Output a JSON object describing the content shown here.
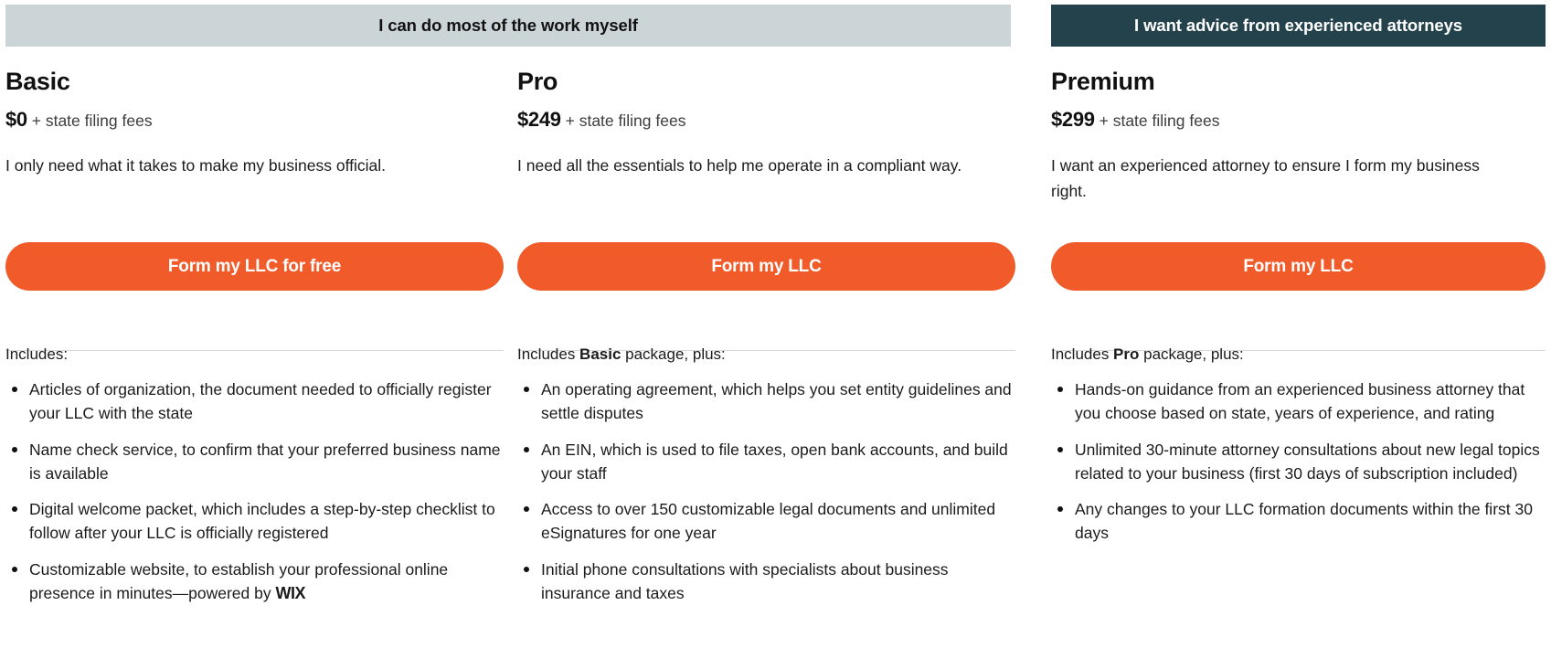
{
  "theme": {
    "accent_orange": "#f15a29",
    "banner_gray": "#cbd4d7",
    "banner_dark": "#24424c",
    "text_dark": "#111111",
    "divider": "#d6d9dc"
  },
  "banners": {
    "left": "I can do most of the work myself",
    "right": "I want advice from experienced attorneys"
  },
  "plans": [
    {
      "name": "Basic",
      "price": "$0",
      "price_suffix": "+ state filing fees",
      "description": "I only need what it takes to make my business official.",
      "cta": "Form my LLC for free",
      "includes_prefix": "Includes:",
      "includes_bold": "",
      "includes_suffix": "",
      "features": [
        "Articles of organization, the document needed to officially register your LLC with the state",
        "Name check service, to confirm that your preferred business name is available",
        "Digital welcome packet, which includes a step-by-step checklist to follow after your LLC is officially registered",
        "Customizable website, to establish your professional online presence in minutes—powered by "
      ],
      "last_feature_brand": "WIX"
    },
    {
      "name": "Pro",
      "price": "$249",
      "price_suffix": "+ state filing fees",
      "description": "I need all the essentials to help me operate in a compliant way.",
      "cta": "Form my LLC",
      "includes_prefix": "Includes ",
      "includes_bold": "Basic",
      "includes_suffix": " package, plus:",
      "features": [
        "An operating agreement, which helps you set entity guidelines and settle disputes",
        "An EIN, which is used to file taxes, open bank accounts, and build your staff",
        "Access to over 150 customizable legal documents and unlimited eSignatures for one year",
        "Initial phone consultations with specialists about business insurance and taxes"
      ],
      "last_feature_brand": ""
    },
    {
      "name": "Premium",
      "price": "$299",
      "price_suffix": "+ state filing fees",
      "description": "I want an experienced attorney to ensure I form my business right.",
      "cta": "Form my LLC",
      "includes_prefix": "Includes ",
      "includes_bold": "Pro",
      "includes_suffix": " package, plus:",
      "features": [
        "Hands-on guidance from an experienced business attorney that you choose based on state, years of experience, and rating",
        "Unlimited 30-minute attorney consultations about new legal topics related to your business (first 30 days of subscription included)",
        "Any changes to your LLC formation documents within the first 30 days"
      ],
      "last_feature_brand": ""
    }
  ]
}
